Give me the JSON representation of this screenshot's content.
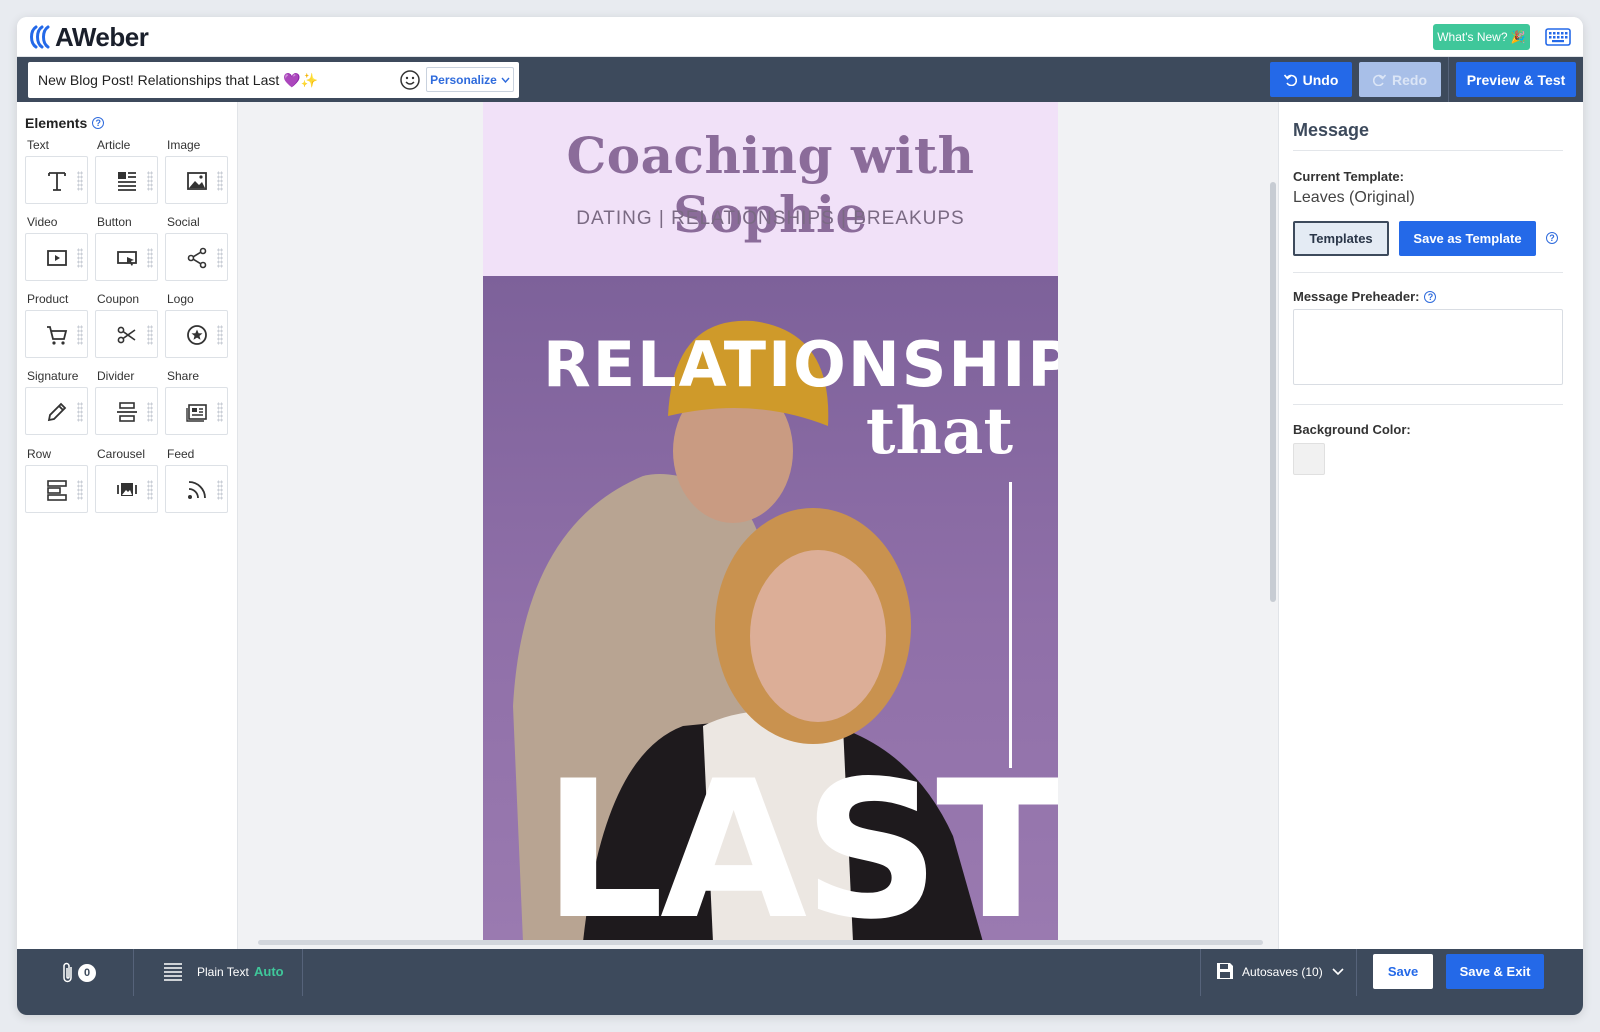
{
  "app": {
    "logo_text": "AWeber",
    "whats_new_label": "What's New? 🎉"
  },
  "toolbar": {
    "subject_value": "New Blog Post! Relationships that Last 💜✨",
    "personalize_label": "Personalize",
    "undo_label": "Undo",
    "redo_label": "Redo",
    "preview_label": "Preview & Test"
  },
  "elements_panel": {
    "title": "Elements",
    "items": [
      {
        "label": "Text",
        "icon": "text-icon"
      },
      {
        "label": "Article",
        "icon": "article-icon"
      },
      {
        "label": "Image",
        "icon": "image-icon"
      },
      {
        "label": "Video",
        "icon": "video-icon"
      },
      {
        "label": "Button",
        "icon": "button-icon"
      },
      {
        "label": "Social",
        "icon": "social-icon"
      },
      {
        "label": "Product",
        "icon": "cart-icon"
      },
      {
        "label": "Coupon",
        "icon": "scissors-icon"
      },
      {
        "label": "Logo",
        "icon": "logo-star-icon"
      },
      {
        "label": "Signature",
        "icon": "pen-icon"
      },
      {
        "label": "Divider",
        "icon": "divider-icon"
      },
      {
        "label": "Share",
        "icon": "share-icon"
      },
      {
        "label": "Row",
        "icon": "row-icon"
      },
      {
        "label": "Carousel",
        "icon": "carousel-icon"
      },
      {
        "label": "Feed",
        "icon": "feed-icon"
      }
    ]
  },
  "email": {
    "header_title": "Coaching with Sophie",
    "header_subtitle": "DATING | RELATIONSHIPS | BREAKUPS",
    "hero_line1": "RELATIONSHIPS",
    "hero_line2": "that",
    "hero_line3": "LAST",
    "header_bg": "#f1e1f8",
    "hero_bg": "#8f6fa8"
  },
  "message_panel": {
    "title": "Message",
    "current_template_label": "Current Template:",
    "current_template_value": "Leaves (Original)",
    "templates_button": "Templates",
    "save_as_template_button": "Save as Template",
    "preheader_label": "Message Preheader:",
    "preheader_value": "",
    "background_color_label": "Background Color:",
    "background_color_value": "#f1f1f1"
  },
  "bottombar": {
    "attachments_count": "0",
    "plain_text_label": "Plain Text",
    "plain_text_mode": "Auto",
    "autosaves_label": "Autosaves (10)",
    "save_label": "Save",
    "save_exit_label": "Save & Exit"
  },
  "colors": {
    "primary": "#2469e8",
    "toolbar": "#3d4a5c",
    "accent_green": "#3fc79a"
  }
}
